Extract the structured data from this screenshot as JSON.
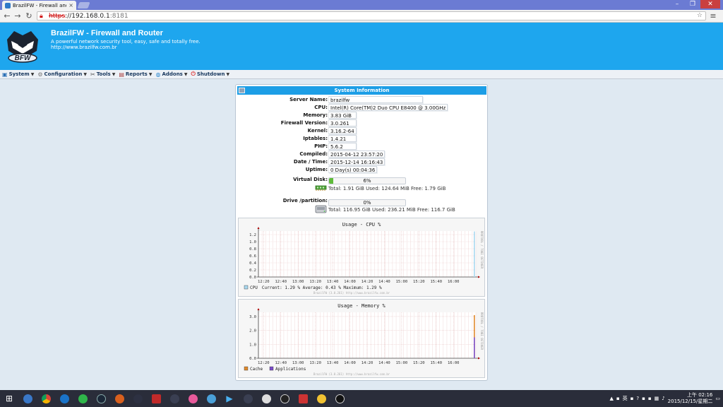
{
  "browser": {
    "tab_title": "BrazilFW - Firewall and R",
    "url_scheme": "https",
    "url_sep": "://",
    "url_host": "192.168.0.1",
    "url_port": ":8181"
  },
  "site": {
    "title": "BrazilFW - Firewall and Router",
    "subtitle": "A powerful network security tool, easy, safe and totally free.",
    "url": "http://www.brazilfw.com.br",
    "logo_text": "BFW"
  },
  "menu": [
    {
      "label": "System"
    },
    {
      "label": "Configuration"
    },
    {
      "label": "Tools"
    },
    {
      "label": "Reports"
    },
    {
      "label": "Addons"
    },
    {
      "label": "Shutdown"
    }
  ],
  "panel": {
    "title": "System Information",
    "rows": [
      {
        "label": "Server Name:",
        "value": "brazilfw"
      },
      {
        "label": "CPU:",
        "value": "Intel(R) Core(TM)2 Duo CPU E8400 @ 3.00GHz"
      },
      {
        "label": "Memory:",
        "value": "3.83 GiB"
      },
      {
        "label": "Firewall Version:",
        "value": "3.0.261"
      },
      {
        "label": "Kernel:",
        "value": "3.16.2-64"
      },
      {
        "label": "Iptables:",
        "value": "1.4.21"
      },
      {
        "label": "PHP:",
        "value": "5.6.2"
      },
      {
        "label": "Compiled:",
        "value": "2015-04-12 23:57:20"
      },
      {
        "label": "Date / Time:",
        "value": "2015-12-14 16:16:43"
      },
      {
        "label": "Uptime:",
        "value": "0 Day(s) 00:04:36"
      }
    ],
    "virtual_disk": {
      "label": "Virtual Disk:",
      "percent_text": "6%",
      "percent": 6,
      "details": "Total: 1.91 GiB Used: 124.64 MiB Free: 1.79 GiB"
    },
    "drive": {
      "label": "Drive /partition:",
      "percent_text": "0%",
      "percent": 0,
      "details": "Total: 116.95 GiB Used: 236.21 MiB Free: 116.7 GiB"
    }
  },
  "chart_data": [
    {
      "type": "line",
      "title": "Usage - CPU %",
      "ylim": [
        0,
        1.3
      ],
      "yticks": [
        "0.0",
        "0.2",
        "0.4",
        "0.6",
        "0.8",
        "1.0",
        "1.2"
      ],
      "ytick_values": [
        0,
        0.2,
        0.4,
        0.6,
        0.8,
        1.0,
        1.2
      ],
      "xticks": [
        "12:20",
        "12:40",
        "13:00",
        "13:20",
        "13:40",
        "14:00",
        "14:20",
        "14:40",
        "15:00",
        "15:20",
        "15:40",
        "16:00"
      ],
      "grid": true,
      "legend": [
        {
          "name": "CPU",
          "color": "#a8d8ef",
          "text": "Current:  1.29 %   Average:  0.43 %   Maximum:  1.29 %"
        }
      ],
      "side_label": "RRDTOOL / TOBI OETIKER",
      "footer": "BrazilFW (3.0.261) http://www.brazilfw.com.br",
      "series": [
        {
          "name": "CPU",
          "color": "#a8d8ef",
          "x": [
            "16:16"
          ],
          "values": [
            1.29
          ]
        }
      ]
    },
    {
      "type": "area",
      "title": "Usage - Memory %",
      "ylim": [
        0,
        3.3
      ],
      "yticks": [
        "0.0",
        "1.0",
        "2.0",
        "3.0"
      ],
      "ytick_values": [
        0,
        1.0,
        2.0,
        3.0
      ],
      "xticks": [
        "12:20",
        "12:40",
        "13:00",
        "13:20",
        "13:40",
        "14:00",
        "14:20",
        "14:40",
        "15:00",
        "15:20",
        "15:40",
        "16:00"
      ],
      "grid": true,
      "legend": [
        {
          "name": "Cache",
          "color": "#e08a2c",
          "text": "Cache"
        },
        {
          "name": "Applications",
          "color": "#7a4cc8",
          "text": "Applications"
        }
      ],
      "side_label": "RRDTOOL / TOBI OETIKER",
      "footer": "BrazilFW (3.0.261) http://www.brazilfw.com.br",
      "series": [
        {
          "name": "Cache",
          "color": "#e08a2c",
          "x": [
            "16:16"
          ],
          "values": [
            3.1
          ]
        },
        {
          "name": "Applications",
          "color": "#7a4cc8",
          "x": [
            "16:16"
          ],
          "values": [
            1.5
          ]
        }
      ]
    }
  ],
  "taskbar": {
    "clock_time": "上午 02:16",
    "clock_date": "2015/12/15/星期二",
    "ime": "英"
  }
}
